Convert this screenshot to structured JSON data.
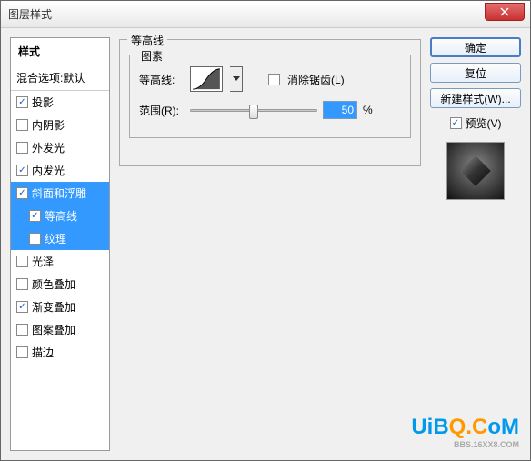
{
  "window": {
    "title": "图层样式"
  },
  "left": {
    "header": "样式",
    "blend": "混合选项:默认",
    "items": [
      {
        "label": "投影",
        "checked": true,
        "sub": false,
        "selected": false
      },
      {
        "label": "内阴影",
        "checked": false,
        "sub": false,
        "selected": false
      },
      {
        "label": "外发光",
        "checked": false,
        "sub": false,
        "selected": false
      },
      {
        "label": "内发光",
        "checked": true,
        "sub": false,
        "selected": false
      },
      {
        "label": "斜面和浮雕",
        "checked": true,
        "sub": false,
        "selected": true
      },
      {
        "label": "等高线",
        "checked": true,
        "sub": true,
        "selected": true
      },
      {
        "label": "纹理",
        "checked": false,
        "sub": true,
        "selected": true
      },
      {
        "label": "光泽",
        "checked": false,
        "sub": false,
        "selected": false
      },
      {
        "label": "颜色叠加",
        "checked": false,
        "sub": false,
        "selected": false
      },
      {
        "label": "渐变叠加",
        "checked": true,
        "sub": false,
        "selected": false
      },
      {
        "label": "图案叠加",
        "checked": false,
        "sub": false,
        "selected": false
      },
      {
        "label": "描边",
        "checked": false,
        "sub": false,
        "selected": false
      }
    ]
  },
  "center": {
    "group_title": "等高线",
    "inner_title": "图素",
    "contour_label": "等高线:",
    "antialias_label": "消除锯齿(L)",
    "antialias_checked": false,
    "range_label": "范围(R):",
    "range_value": "50",
    "range_unit": "%",
    "range_percent": 50
  },
  "right": {
    "ok": "确定",
    "cancel": "复位",
    "new_style": "新建样式(W)...",
    "preview_label": "预览(V)",
    "preview_checked": true
  },
  "watermark": {
    "text1": "UiB",
    "text2": "Q.C",
    "text3": "oM",
    "sub": "BBS.16XX8.COM"
  }
}
